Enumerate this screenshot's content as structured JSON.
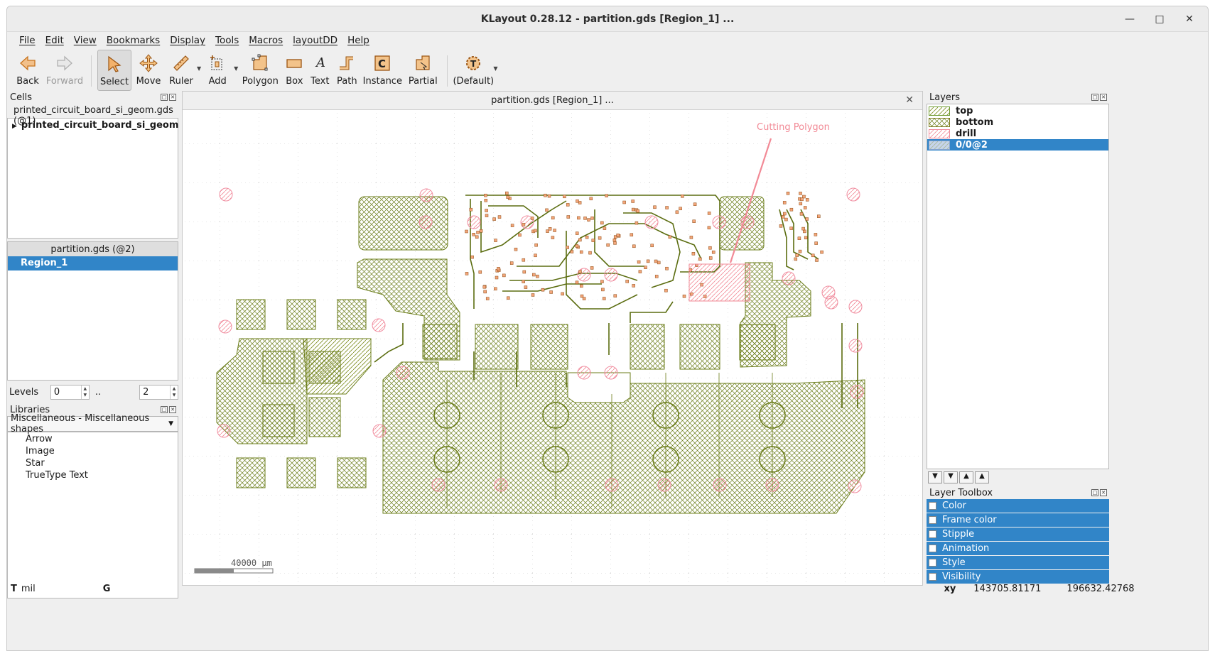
{
  "window": {
    "title": "KLayout 0.28.12 - partition.gds [Region_1] ..."
  },
  "menu": [
    "File",
    "Edit",
    "View",
    "Bookmarks",
    "Display",
    "Tools",
    "Macros",
    "layoutDD",
    "Help"
  ],
  "toolbar": {
    "back": "Back",
    "forward": "Forward",
    "select": "Select",
    "move": "Move",
    "ruler": "Ruler",
    "add": "Add",
    "polygon": "Polygon",
    "box": "Box",
    "text": "Text",
    "path": "Path",
    "instance": "Instance",
    "partial": "Partial",
    "default": "(Default)"
  },
  "cells": {
    "title": "Cells",
    "file": "printed_circuit_board_si_geom.gds (@1)",
    "tree_item": "printed_circuit_board_si_geom"
  },
  "partition": {
    "header": "partition.gds (@2)",
    "item": "Region_1"
  },
  "levels": {
    "label": "Levels",
    "from": "0",
    "sep": "..",
    "to": "2"
  },
  "libraries": {
    "title": "Libraries",
    "selected": "Miscellaneous - Miscellaneous shapes",
    "items": [
      "Arrow",
      "Image",
      "Star",
      "TrueType Text"
    ]
  },
  "canvas": {
    "tab_title": "partition.gds [Region_1] ...",
    "annotation": "Cutting Polygon",
    "scale_label": "40000 µm"
  },
  "layers": {
    "title": "Layers",
    "items": [
      {
        "name": "top",
        "color": "#6b9a2e"
      },
      {
        "name": "bottom",
        "color": "#7a7a1a"
      },
      {
        "name": "drill",
        "color": "#ee8a9a"
      },
      {
        "name": "0/0@2",
        "color": "#8aa6cf"
      }
    ],
    "selected_index": 3
  },
  "toolbox": {
    "title": "Layer Toolbox",
    "items": [
      "Color",
      "Frame color",
      "Stipple",
      "Animation",
      "Style",
      "Visibility"
    ]
  },
  "status": {
    "t": "T",
    "unit": "mil",
    "g": "G",
    "xy_label": "xy",
    "x": "143705.81171",
    "y": "196632.42768"
  },
  "colors": {
    "accent": "#3185c8",
    "top": "#6b8f1e",
    "drill": "#f08da0",
    "region": "#f28a96"
  }
}
